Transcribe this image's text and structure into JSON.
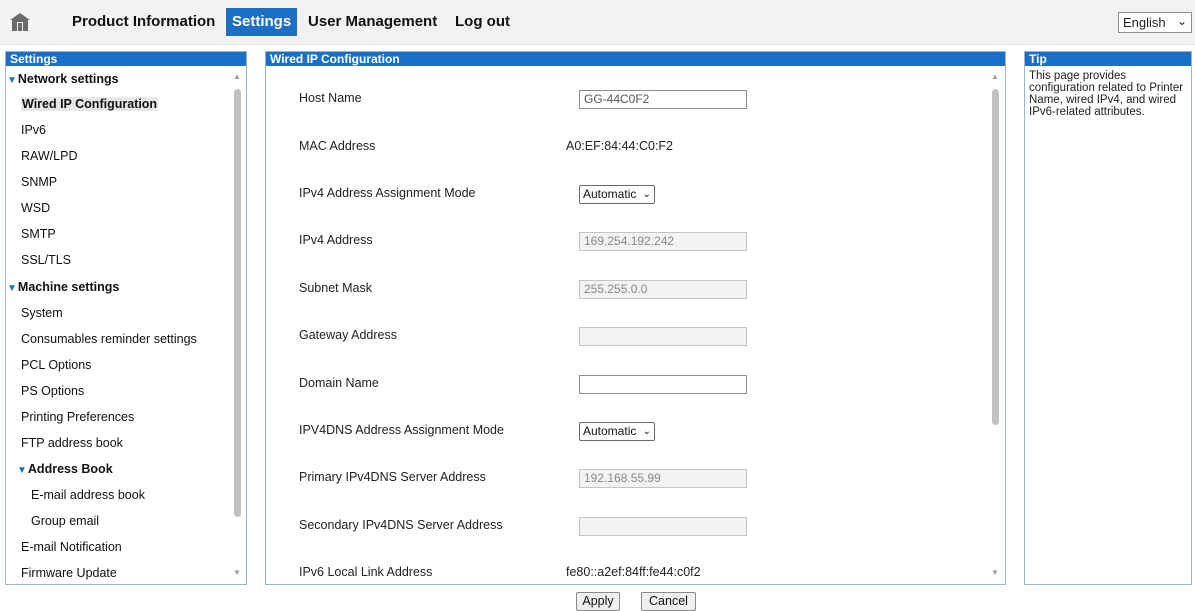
{
  "nav": {
    "items": [
      {
        "label": "Product Information"
      },
      {
        "label": "Settings"
      },
      {
        "label": "User Management"
      },
      {
        "label": "Log out"
      }
    ],
    "language": "English"
  },
  "sidebar": {
    "title": "Settings",
    "groups": {
      "network": "Network settings",
      "machine": "Machine settings",
      "address_book": "Address Book"
    },
    "items": [
      "Wired IP Configuration",
      "IPv6",
      "RAW/LPD",
      "SNMP",
      "WSD",
      "SMTP",
      "SSL/TLS",
      "System",
      "Consumables reminder settings",
      "PCL Options",
      "PS Options",
      "Printing Preferences",
      "FTP address book",
      "E-mail address book",
      "Group email",
      "E-mail Notification",
      "Firmware Update"
    ]
  },
  "main": {
    "title": "Wired IP Configuration",
    "fields": {
      "host_name": {
        "label": "Host Name",
        "value": "GG-44C0F2"
      },
      "mac": {
        "label": "MAC Address",
        "value": "A0:EF:84:44:C0:F2"
      },
      "ipv4_mode": {
        "label": "IPv4 Address Assignment Mode",
        "value": "Automatic"
      },
      "ipv4": {
        "label": "IPv4 Address",
        "value": "169.254.192.242"
      },
      "subnet": {
        "label": "Subnet Mask",
        "value": "255.255.0.0"
      },
      "gateway": {
        "label": "Gateway Address",
        "value": ""
      },
      "domain": {
        "label": "Domain Name",
        "value": ""
      },
      "dns_mode": {
        "label": "IPV4DNS Address Assignment Mode",
        "value": "Automatic"
      },
      "dns_primary": {
        "label": "Primary IPv4DNS Server Address",
        "value": "192.168.55.99"
      },
      "dns_secondary": {
        "label": "Secondary IPv4DNS Server Address",
        "value": ""
      },
      "ipv6_link": {
        "label": "IPv6 Local Link Address",
        "value": "fe80::a2ef:84ff:fe44:c0f2"
      }
    }
  },
  "tip": {
    "title": "Tip",
    "text": "This page provides configuration related to Printer Name, wired IPv4, and wired IPv6-related attributes."
  },
  "actions": {
    "apply": "Apply",
    "cancel": "Cancel"
  },
  "colors": {
    "accent": "#1b6fc4"
  }
}
